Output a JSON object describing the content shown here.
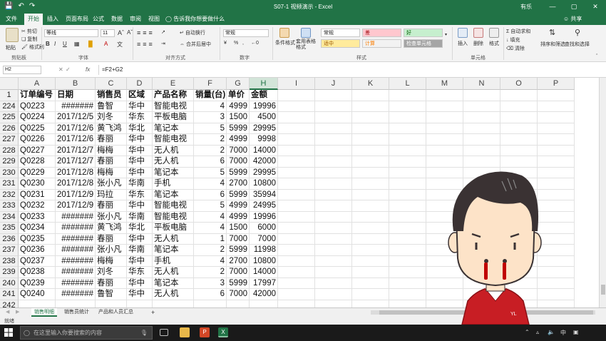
{
  "titlebar": {
    "title": "S07-1 视频演示 - Excel",
    "user": "有乐",
    "min": "—",
    "max": "▢",
    "close": "✕",
    "save_icon": "save-icon",
    "undo_icon": "undo-icon",
    "redo_icon": "redo-icon"
  },
  "tabs": {
    "items": [
      "文件",
      "开始",
      "插入",
      "页面布局",
      "公式",
      "数据",
      "审阅",
      "视图"
    ],
    "tell_me": "告诉我你想要做什么",
    "share": "共享"
  },
  "ribbon": {
    "clipboard": {
      "label": "剪贴板",
      "paste": "粘贴",
      "cut": "剪切",
      "copy": "复制",
      "format_painter": "格式刷"
    },
    "font": {
      "label": "字体",
      "family": "等线",
      "size": "11",
      "bold": "B",
      "italic": "I",
      "underline": "U"
    },
    "alignment": {
      "label": "对齐方式",
      "wrap": "自动换行",
      "merge": "合并后居中"
    },
    "number": {
      "label": "数字",
      "format": "常规",
      "percent": "%",
      "comma": ","
    },
    "styles": {
      "label": "样式",
      "conditional": "条件格式",
      "table": "套用表格格式",
      "cells": [
        {
          "text": "常规",
          "bg": "#ffffff",
          "color": "#222222"
        },
        {
          "text": "差",
          "bg": "#ffc7ce",
          "color": "#9c0006"
        },
        {
          "text": "好",
          "bg": "#c6efce",
          "color": "#006100"
        },
        {
          "text": "适中",
          "bg": "#ffeb9c",
          "color": "#9c5700"
        },
        {
          "text": "计算",
          "bg": "#f2f2f2",
          "color": "#fa7d00"
        },
        {
          "text": "检查单元格",
          "bg": "#a5a5a5",
          "color": "#ffffff"
        }
      ]
    },
    "cells": {
      "label": "单元格",
      "insert": "插入",
      "delete": "删除",
      "format": "格式"
    },
    "editing": {
      "autosum": "自动求和",
      "fill": "填充",
      "clear": "清除",
      "sort": "排序和筛选",
      "find": "查找和选择"
    }
  },
  "formula_bar": {
    "name_box": "H2",
    "fx": "fx",
    "cancel": "✕",
    "enter": "✓",
    "formula": "=F2+G2"
  },
  "grid": {
    "columns": [
      "A",
      "B",
      "C",
      "D",
      "E",
      "F",
      "G",
      "H",
      "I",
      "J",
      "K",
      "L",
      "M",
      "N",
      "O",
      "P"
    ],
    "selected_column": "H",
    "header_row": {
      "num": "1",
      "cells": [
        "订单编号",
        "日期",
        "销售员",
        "区域",
        "产品名称",
        "销量(台)",
        "单价",
        "金额"
      ]
    },
    "rows": [
      {
        "num": "224",
        "cells": [
          "Q0223",
          "#######",
          "鲁智",
          "华中",
          "智能电视",
          "4",
          "4999",
          "19996"
        ]
      },
      {
        "num": "225",
        "cells": [
          "Q0224",
          "2017/12/5",
          "刘冬",
          "华东",
          "平板电脑",
          "3",
          "1500",
          "4500"
        ]
      },
      {
        "num": "226",
        "cells": [
          "Q0225",
          "2017/12/6",
          "黄飞鸿",
          "华北",
          "笔记本",
          "5",
          "5999",
          "29995"
        ]
      },
      {
        "num": "227",
        "cells": [
          "Q0226",
          "2017/12/6",
          "春丽",
          "华中",
          "智能电视",
          "2",
          "4999",
          "9998"
        ]
      },
      {
        "num": "228",
        "cells": [
          "Q0227",
          "2017/12/7",
          "梅梅",
          "华中",
          "无人机",
          "2",
          "7000",
          "14000"
        ]
      },
      {
        "num": "229",
        "cells": [
          "Q0228",
          "2017/12/7",
          "春丽",
          "华中",
          "无人机",
          "6",
          "7000",
          "42000"
        ]
      },
      {
        "num": "230",
        "cells": [
          "Q0229",
          "2017/12/8",
          "梅梅",
          "华中",
          "笔记本",
          "5",
          "5999",
          "29995"
        ]
      },
      {
        "num": "231",
        "cells": [
          "Q0230",
          "2017/12/8",
          "张小凡",
          "华南",
          "手机",
          "4",
          "2700",
          "10800"
        ]
      },
      {
        "num": "232",
        "cells": [
          "Q0231",
          "2017/12/9",
          "玛拉",
          "华东",
          "笔记本",
          "6",
          "5999",
          "35994"
        ]
      },
      {
        "num": "233",
        "cells": [
          "Q0232",
          "2017/12/9",
          "春丽",
          "华中",
          "智能电视",
          "5",
          "4999",
          "24995"
        ]
      },
      {
        "num": "234",
        "cells": [
          "Q0233",
          "#######",
          "张小凡",
          "华南",
          "智能电视",
          "4",
          "4999",
          "19996"
        ]
      },
      {
        "num": "235",
        "cells": [
          "Q0234",
          "#######",
          "黄飞鸿",
          "华北",
          "平板电脑",
          "4",
          "1500",
          "6000"
        ]
      },
      {
        "num": "236",
        "cells": [
          "Q0235",
          "#######",
          "春丽",
          "华中",
          "无人机",
          "1",
          "7000",
          "7000"
        ]
      },
      {
        "num": "237",
        "cells": [
          "Q0236",
          "#######",
          "张小凡",
          "华南",
          "笔记本",
          "2",
          "5999",
          "11998"
        ]
      },
      {
        "num": "238",
        "cells": [
          "Q0237",
          "#######",
          "梅梅",
          "华中",
          "手机",
          "4",
          "2700",
          "10800"
        ]
      },
      {
        "num": "239",
        "cells": [
          "Q0238",
          "#######",
          "刘冬",
          "华东",
          "无人机",
          "2",
          "7000",
          "14000"
        ]
      },
      {
        "num": "240",
        "cells": [
          "Q0239",
          "#######",
          "春丽",
          "华中",
          "笔记本",
          "3",
          "5999",
          "17997"
        ]
      },
      {
        "num": "241",
        "cells": [
          "Q0240",
          "#######",
          "鲁智",
          "华中",
          "无人机",
          "6",
          "7000",
          "42000"
        ]
      },
      {
        "num": "242",
        "cells": [
          "",
          "",
          "",
          "",
          "",
          "",
          "",
          ""
        ]
      }
    ]
  },
  "sheets": {
    "tabs": [
      "销售明细",
      "销售员统计",
      "产品和人员汇总"
    ],
    "active": 0,
    "add": "+"
  },
  "status": {
    "ready": "就绪"
  },
  "taskbar": {
    "search_placeholder": "在这里输入你要搜索的内容",
    "ime": "中",
    "tray_icon": "wifi-icon"
  },
  "cartoon": {
    "badge": "YL",
    "skin": "#fde3c8",
    "hair": "#3a3233",
    "shirt": "#c81e24",
    "blood": "#c00000"
  },
  "colors": {
    "excel_green": "#217346"
  }
}
